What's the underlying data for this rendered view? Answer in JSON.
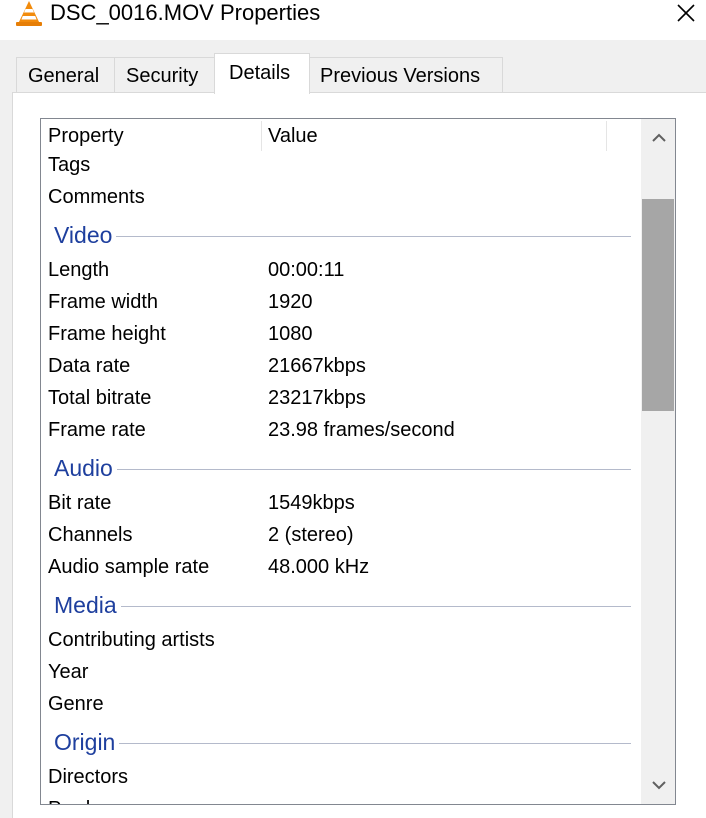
{
  "window": {
    "title": "DSC_0016.MOV Properties",
    "app_icon": "vlc-cone-icon",
    "close_glyph": "✕"
  },
  "tabs": [
    {
      "label": "General"
    },
    {
      "label": "Security"
    },
    {
      "label": "Details",
      "selected": true
    },
    {
      "label": "Previous Versions"
    }
  ],
  "details": {
    "columns": {
      "property": "Property",
      "value": "Value"
    },
    "top_rows": [
      {
        "property": "Tags",
        "value": ""
      },
      {
        "property": "Comments",
        "value": ""
      }
    ],
    "groups": {
      "video": "Video",
      "audio": "Audio",
      "media": "Media",
      "origin": "Origin"
    },
    "video_rows": [
      {
        "property": "Length",
        "value": "00:00:11"
      },
      {
        "property": "Frame width",
        "value": "1920"
      },
      {
        "property": "Frame height",
        "value": "1080"
      },
      {
        "property": "Data rate",
        "value": "21667kbps"
      },
      {
        "property": "Total bitrate",
        "value": "23217kbps"
      },
      {
        "property": "Frame rate",
        "value": "23.98 frames/second"
      }
    ],
    "audio_rows": [
      {
        "property": "Bit rate",
        "value": "1549kbps"
      },
      {
        "property": "Channels",
        "value": "2 (stereo)"
      },
      {
        "property": "Audio sample rate",
        "value": "48.000 kHz"
      }
    ],
    "media_rows": [
      {
        "property": "Contributing artists",
        "value": ""
      },
      {
        "property": "Year",
        "value": ""
      },
      {
        "property": "Genre",
        "value": ""
      }
    ],
    "origin_rows": [
      {
        "property": "Directors",
        "value": ""
      },
      {
        "property": "Producers",
        "value": ""
      }
    ]
  },
  "colors": {
    "group_header": "#1e3f9e",
    "scrollbar_thumb": "#a6a6a6"
  }
}
